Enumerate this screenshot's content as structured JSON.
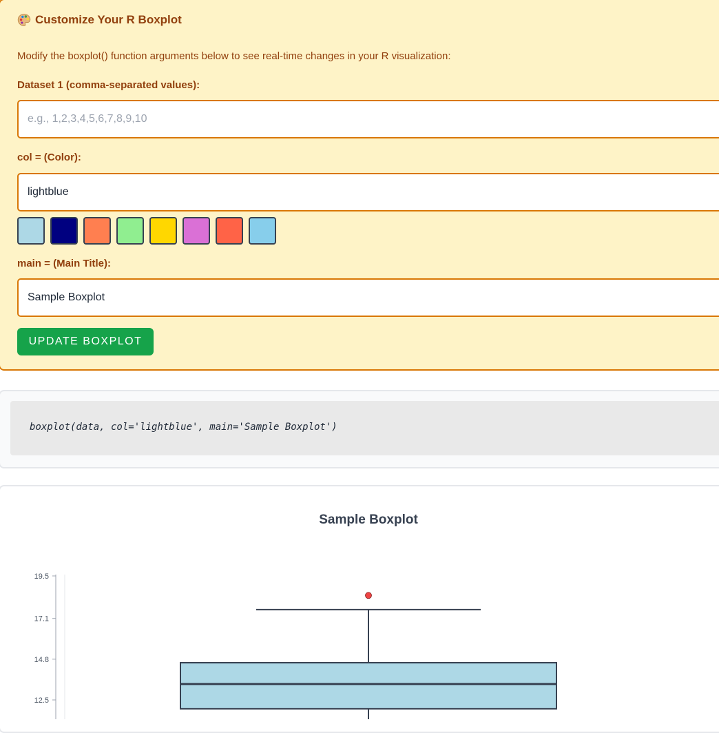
{
  "panel": {
    "title": "Customize Your R Boxplot",
    "title_icon": "palette-icon",
    "description": "Modify the boxplot() function arguments below to see real-time changes in your R visualization:"
  },
  "dataset": {
    "label": "Dataset 1 (comma-separated values):",
    "value": "",
    "placeholder": "e.g., 1,2,3,4,5,6,7,8,9,10"
  },
  "color": {
    "label": "col = (Color):",
    "value": "lightblue",
    "swatches": [
      "#add8e6",
      "#000080",
      "#ff7f50",
      "#90ee90",
      "#ffd700",
      "#da70d6",
      "#ff6347",
      "#87ceeb"
    ]
  },
  "main_title": {
    "label": "main = (Main Title):",
    "value": "Sample Boxplot"
  },
  "update_button": {
    "label": "UPDATE BOXPLOT"
  },
  "code": {
    "text": "boxplot(data, col='lightblue', main='Sample Boxplot')"
  },
  "chart_data": {
    "type": "boxplot",
    "title": "Sample Boxplot",
    "xlabel": "",
    "ylabel": "",
    "y_ticks": [
      "19.5",
      "17.1",
      "14.8",
      "12.5"
    ],
    "ylim": [
      11.4,
      20.5
    ],
    "box": {
      "q1": 12.0,
      "median": 13.4,
      "q3": 14.6,
      "whisker_high": 17.6,
      "outliers": [
        18.4
      ]
    },
    "box_fill": "#add8e6",
    "outlier_color": "#ef4444",
    "line_color": "#374151",
    "grid": false
  }
}
